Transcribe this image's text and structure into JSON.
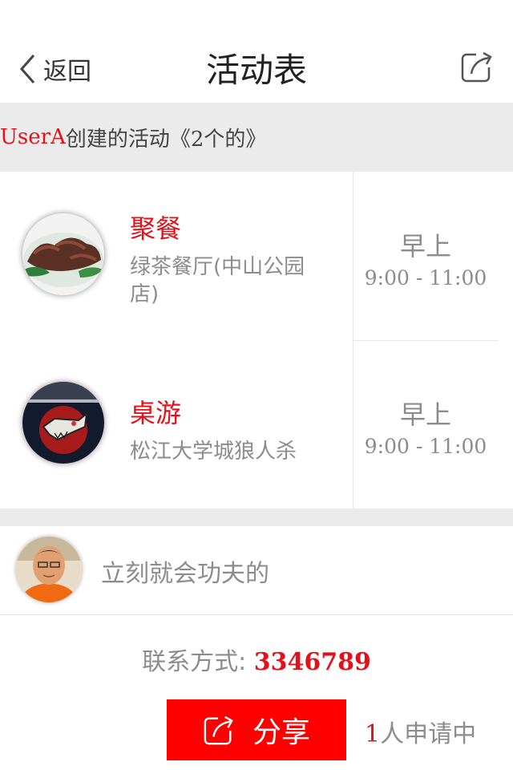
{
  "navbar": {
    "back_label": "返回",
    "title": "活动表",
    "share_icon": "share-icon"
  },
  "section": {
    "user": "UserA",
    "text": "创建的活动《2个的》"
  },
  "activities": [
    {
      "title": "聚餐",
      "location": "绿茶餐厅(中山公园店)",
      "time_label": "早上",
      "time_range": "9:00 - 11:00"
    },
    {
      "title": "桌游",
      "location": "松江大学城狼人杀",
      "time_label": "早上",
      "time_range": "9:00 - 11:00"
    }
  ],
  "poster": {
    "text": "立刻就会功夫的"
  },
  "contact": {
    "label": "联系方式:",
    "phone": "3346789"
  },
  "share": {
    "label": "分享"
  },
  "applicants": {
    "count": "1",
    "text": "人申请中"
  },
  "colors": {
    "accent": "#e3101a",
    "button": "#ff0000",
    "gray_text": "#8c8c8c",
    "section_bg": "#ebebeb"
  }
}
